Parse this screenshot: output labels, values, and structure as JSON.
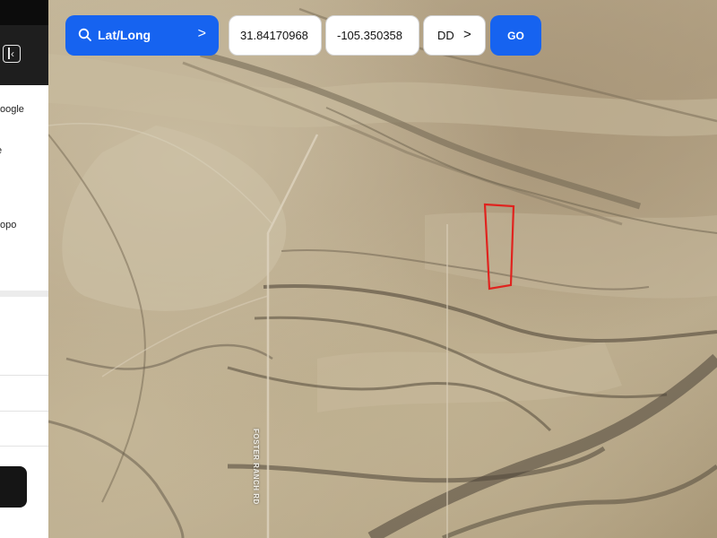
{
  "search": {
    "mode_label": "Lat/Long",
    "latitude": "31.84170968",
    "longitude": "-105.350358",
    "format": "DD",
    "go_label": "GO",
    "accent_color": "#1663f0"
  },
  "sidebar": {
    "items": [
      {
        "label": "oogle"
      },
      {
        "label": "e"
      },
      {
        "label": "opo"
      }
    ]
  },
  "map": {
    "road_label": "FOSTER RANCH RD",
    "boundary_color": "#e0231e"
  }
}
